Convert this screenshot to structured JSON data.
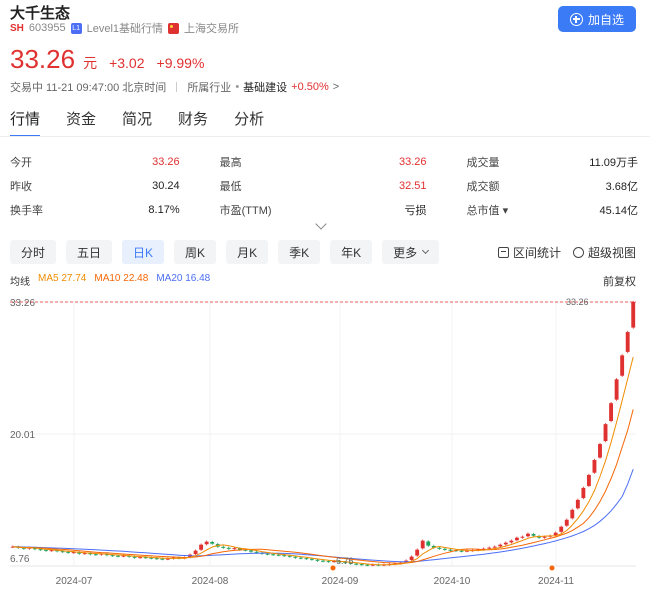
{
  "stock": {
    "name": "大千生态",
    "market": "SH",
    "code": "603955",
    "level_badge": "L1",
    "level_text": "Level1基础行情",
    "exchange": "上海交易所"
  },
  "add_button": {
    "label": "加自选",
    "icon": "plus-circle-icon"
  },
  "quote": {
    "price": "33.26",
    "unit": "元",
    "change": "+3.02",
    "change_pct": "+9.99%",
    "color": "#e03131"
  },
  "status": {
    "state": "交易中 11-21 09:47:00 北京时间",
    "industry_label": "所属行业",
    "industry_name": "基础建设",
    "industry_change": "+0.50%",
    "industry_arrow": ">"
  },
  "tabs": [
    {
      "label": "行情",
      "active": true
    },
    {
      "label": "资金"
    },
    {
      "label": "简况"
    },
    {
      "label": "财务"
    },
    {
      "label": "分析"
    }
  ],
  "stats": [
    [
      {
        "label": "今开",
        "value": "33.26",
        "tone": "red"
      },
      {
        "label": "最高",
        "value": "33.26",
        "tone": "red"
      },
      {
        "label": "成交量",
        "value": "11.09万手"
      }
    ],
    [
      {
        "label": "昨收",
        "value": "30.24"
      },
      {
        "label": "最低",
        "value": "32.51",
        "tone": "red"
      },
      {
        "label": "成交额",
        "value": "3.68亿"
      }
    ],
    [
      {
        "label": "换手率",
        "value": "8.17%"
      },
      {
        "label": "市盈(TTM)",
        "value": "亏损"
      },
      {
        "label": "总市值 ▾",
        "value": "45.14亿"
      }
    ]
  ],
  "periods": [
    {
      "label": "分时"
    },
    {
      "label": "五日"
    },
    {
      "label": "日K",
      "active": true
    },
    {
      "label": "周K"
    },
    {
      "label": "月K"
    },
    {
      "label": "季K"
    },
    {
      "label": "年K"
    },
    {
      "label": "更多",
      "dropdown": true
    }
  ],
  "tools": {
    "range": "区间统计",
    "zoom": "超级视图"
  },
  "ma": {
    "label": "均线",
    "ma5": "MA5 27.74",
    "ma10": "MA10 22.48",
    "ma20": "MA20 16.48",
    "ma5_color": "#f08c00",
    "ma10_color": "#f76707",
    "ma20_color": "#4c6ef5"
  },
  "fuquan": "前复权",
  "chart_data": {
    "type": "candlestick",
    "y_ticks": [
      "33.26",
      "20.01",
      "6.76"
    ],
    "ylim": [
      6.76,
      33.26
    ],
    "x_ticks": [
      "2024-07",
      "2024-08",
      "2024-09",
      "2024-10",
      "2024-11"
    ],
    "max_marker": "33.26",
    "min_marker": "6.76",
    "up_color": "#e03131",
    "down_color": "#20a35b",
    "closes": [
      8.7,
      8.6,
      8.5,
      8.6,
      8.45,
      8.4,
      8.3,
      8.35,
      8.25,
      8.2,
      8.1,
      8.15,
      8.0,
      8.05,
      7.95,
      7.9,
      8.0,
      7.85,
      7.8,
      7.75,
      7.8,
      7.7,
      7.6,
      7.65,
      7.6,
      7.55,
      7.5,
      7.45,
      7.5,
      7.6,
      7.55,
      7.6,
      7.9,
      8.3,
      8.9,
      9.2,
      9.0,
      8.7,
      8.6,
      8.5,
      8.55,
      8.4,
      8.35,
      8.2,
      8.1,
      8.0,
      7.95,
      7.9,
      7.85,
      7.8,
      7.7,
      7.6,
      7.55,
      7.5,
      7.4,
      7.3,
      7.25,
      7.2,
      7.25,
      7.15,
      7.1,
      7.0,
      6.95,
      6.9,
      6.85,
      6.9,
      6.85,
      6.9,
      6.95,
      7.0,
      7.1,
      7.3,
      7.7,
      8.4,
      9.3,
      8.8,
      8.6,
      8.5,
      8.4,
      8.35,
      8.3,
      8.25,
      8.3,
      8.35,
      8.4,
      8.5,
      8.6,
      8.7,
      8.9,
      9.1,
      9.3,
      9.6,
      9.7,
      10.0,
      9.8,
      9.6,
      9.7,
      9.8,
      10.1,
      10.7,
      11.4,
      12.4,
      13.4,
      14.6,
      15.9,
      17.4,
      19.0,
      21.0,
      23.1,
      25.5,
      27.9,
      30.24,
      33.26
    ],
    "ma5": [
      8.7,
      8.65,
      8.6,
      8.6,
      8.57,
      8.51,
      8.44,
      8.4,
      8.35,
      8.3,
      8.24,
      8.2,
      8.14,
      8.1,
      8.05,
      8.01,
      7.99,
      7.95,
      7.9,
      7.86,
      7.84,
      7.78,
      7.73,
      7.7,
      7.67,
      7.62,
      7.58,
      7.55,
      7.52,
      7.52,
      7.52,
      7.54,
      7.63,
      7.79,
      8.05,
      8.38,
      8.66,
      8.82,
      8.88,
      8.8,
      8.67,
      8.55,
      8.49,
      8.4,
      8.32,
      8.21,
      8.12,
      8.03,
      7.96,
      7.9,
      7.84,
      7.77,
      7.7,
      7.63,
      7.55,
      7.47,
      7.4,
      7.33,
      7.28,
      7.23,
      7.19,
      7.14,
      7.09,
      7.02,
      6.96,
      6.91,
      6.89,
      6.88,
      6.89,
      6.92,
      6.96,
      7.05,
      7.21,
      7.5,
      7.96,
      8.3,
      8.62,
      8.72,
      8.62,
      8.53,
      8.44,
      8.37,
      8.32,
      8.31,
      8.32,
      8.36,
      8.43,
      8.51,
      8.62,
      8.76,
      8.92,
      9.12,
      9.32,
      9.54,
      9.68,
      9.72,
      9.76,
      9.78,
      9.8,
      9.98,
      10.32,
      10.88,
      11.52,
      12.3,
      13.2,
      14.34,
      15.74,
      17.32,
      19.18,
      21.2,
      23.38,
      25.55,
      27.74
    ],
    "ma10": [
      8.7,
      8.67,
      8.63,
      8.62,
      8.6,
      8.57,
      8.54,
      8.5,
      8.46,
      8.43,
      8.39,
      8.34,
      8.29,
      8.24,
      8.2,
      8.15,
      8.11,
      8.08,
      8.04,
      8.0,
      7.96,
      7.92,
      7.88,
      7.85,
      7.81,
      7.78,
      7.74,
      7.71,
      7.68,
      7.66,
      7.63,
      7.61,
      7.62,
      7.66,
      7.74,
      7.85,
      7.98,
      8.1,
      8.2,
      8.27,
      8.33,
      8.37,
      8.41,
      8.43,
      8.44,
      8.44,
      8.4,
      8.34,
      8.29,
      8.24,
      8.2,
      8.14,
      8.07,
      8.0,
      7.93,
      7.85,
      7.77,
      7.7,
      7.63,
      7.56,
      7.5,
      7.44,
      7.38,
      7.32,
      7.26,
      7.21,
      7.16,
      7.11,
      7.08,
      7.05,
      7.04,
      7.06,
      7.11,
      7.21,
      7.37,
      7.55,
      7.73,
      7.89,
      8.04,
      8.18,
      8.33,
      8.42,
      8.47,
      8.47,
      8.44,
      8.4,
      8.4,
      8.42,
      8.47,
      8.55,
      8.64,
      8.74,
      8.85,
      8.98,
      9.11,
      9.25,
      9.39,
      9.53,
      9.67,
      9.87,
      10.06,
      10.31,
      10.66,
      11.04,
      11.61,
      12.36,
      13.23,
      14.28,
      15.54,
      16.96,
      18.71,
      20.39,
      22.48
    ],
    "ma20": [
      8.7,
      8.69,
      8.67,
      8.66,
      8.64,
      8.62,
      8.6,
      8.58,
      8.56,
      8.54,
      8.52,
      8.5,
      8.47,
      8.45,
      8.42,
      8.39,
      8.36,
      8.33,
      8.3,
      8.27,
      8.24,
      8.2,
      8.16,
      8.12,
      8.08,
      8.04,
      8.0,
      7.96,
      7.92,
      7.88,
      7.84,
      7.81,
      7.78,
      7.77,
      7.78,
      7.8,
      7.83,
      7.86,
      7.89,
      7.92,
      7.95,
      7.98,
      8.0,
      8.02,
      8.04,
      8.05,
      8.05,
      8.04,
      8.03,
      8.02,
      8.0,
      7.97,
      7.93,
      7.89,
      7.85,
      7.81,
      7.76,
      7.71,
      7.66,
      7.61,
      7.56,
      7.51,
      7.47,
      7.43,
      7.39,
      7.35,
      7.31,
      7.27,
      7.24,
      7.21,
      7.19,
      7.18,
      7.19,
      7.22,
      7.27,
      7.33,
      7.39,
      7.45,
      7.51,
      7.57,
      7.63,
      7.69,
      7.75,
      7.81,
      7.87,
      7.94,
      8.01,
      8.09,
      8.17,
      8.26,
      8.35,
      8.45,
      8.55,
      8.66,
      8.77,
      8.89,
      9.01,
      9.14,
      9.28,
      9.44,
      9.6,
      9.78,
      9.99,
      10.22,
      10.5,
      10.84,
      11.25,
      11.73,
      12.3,
      12.97,
      13.74,
      14.98,
      16.48
    ]
  }
}
